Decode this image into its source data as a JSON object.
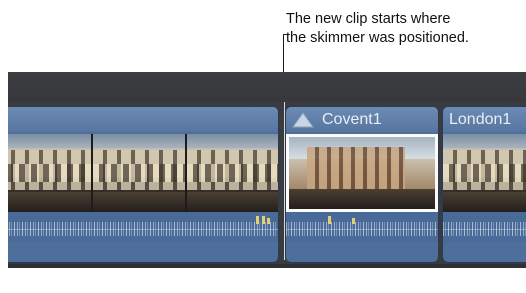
{
  "callout": {
    "line1": "The new clip starts where",
    "line2": "the skimmer was positioned."
  },
  "clips": [
    {
      "title": "",
      "icon": "none"
    },
    {
      "title": "Covent1",
      "icon": "audio-clip-icon"
    },
    {
      "title": "London1",
      "icon": "none"
    }
  ],
  "colors": {
    "clip_fill": "#4e6e9c",
    "clip_header": "#6c8ab4",
    "timeline_bg": "#3a3b3f",
    "waveform_peak": "#e3cf75"
  }
}
